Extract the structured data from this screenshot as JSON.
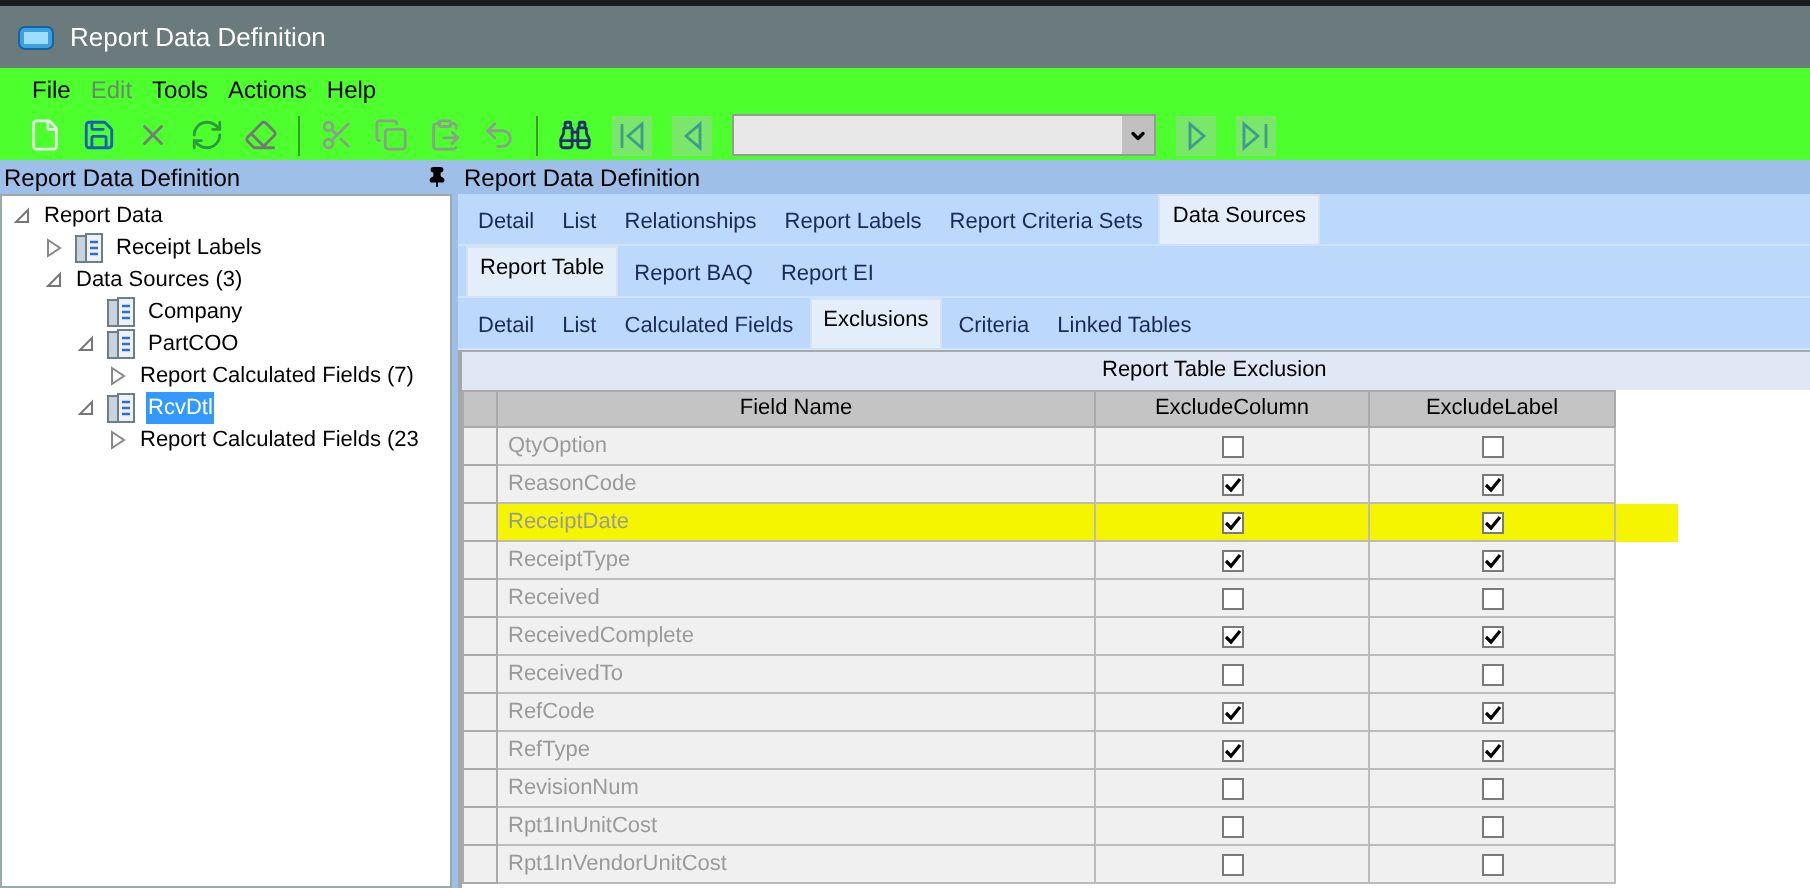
{
  "window": {
    "title": "Report Data Definition"
  },
  "menu": [
    {
      "label": "File",
      "disabled": false
    },
    {
      "label": "Edit",
      "disabled": true
    },
    {
      "label": "Tools",
      "disabled": false
    },
    {
      "label": "Actions",
      "disabled": false
    },
    {
      "label": "Help",
      "disabled": false
    }
  ],
  "left_panel": {
    "title": "Report Data Definition",
    "tree": [
      {
        "label": "Report Data",
        "expanded": true,
        "selected": false,
        "children": [
          {
            "label": "Receipt Labels",
            "kind": "book",
            "expanded": false,
            "selected": false
          },
          {
            "label": "Data Sources (3)",
            "expanded": true,
            "selected": false,
            "children": [
              {
                "label": "Company",
                "kind": "book",
                "selected": false
              },
              {
                "label": "PartCOO",
                "kind": "book",
                "expanded": true,
                "selected": false,
                "children": [
                  {
                    "label": "Report Calculated Fields (7)",
                    "expanded": false,
                    "selected": false
                  }
                ]
              },
              {
                "label": "RcvDtl",
                "kind": "book",
                "expanded": true,
                "selected": true,
                "children": [
                  {
                    "label": "Report Calculated Fields (23",
                    "expanded": false,
                    "selected": false
                  }
                ]
              }
            ]
          }
        ]
      }
    ]
  },
  "right_panel": {
    "title": "Report Data Definition",
    "tab_rows": [
      [
        {
          "label": "Detail",
          "selected": false
        },
        {
          "label": "List",
          "selected": false
        },
        {
          "label": "Relationships",
          "selected": false
        },
        {
          "label": "Report Labels",
          "selected": false
        },
        {
          "label": "Report Criteria Sets",
          "selected": false
        },
        {
          "label": "Data Sources",
          "selected": true
        }
      ],
      [
        {
          "label": "Report Table",
          "selected": true
        },
        {
          "label": "Report BAQ",
          "selected": false
        },
        {
          "label": "Report EI",
          "selected": false
        }
      ],
      [
        {
          "label": "Detail",
          "selected": false
        },
        {
          "label": "List",
          "selected": false
        },
        {
          "label": "Calculated Fields",
          "selected": false
        },
        {
          "label": "Exclusions",
          "selected": true
        },
        {
          "label": "Criteria",
          "selected": false
        },
        {
          "label": "Linked Tables",
          "selected": false
        }
      ]
    ],
    "grid": {
      "caption": "Report Table Exclusion",
      "columns": [
        "Field Name",
        "ExcludeColumn",
        "ExcludeLabel"
      ],
      "rows": [
        {
          "field": "QtyOption",
          "exclude_column": false,
          "exclude_label": false,
          "highlighted": false
        },
        {
          "field": "ReasonCode",
          "exclude_column": true,
          "exclude_label": true,
          "highlighted": false
        },
        {
          "field": "ReceiptDate",
          "exclude_column": true,
          "exclude_label": true,
          "highlighted": true
        },
        {
          "field": "ReceiptType",
          "exclude_column": true,
          "exclude_label": true,
          "highlighted": false
        },
        {
          "field": "Received",
          "exclude_column": false,
          "exclude_label": false,
          "highlighted": false
        },
        {
          "field": "ReceivedComplete",
          "exclude_column": true,
          "exclude_label": true,
          "highlighted": false
        },
        {
          "field": "ReceivedTo",
          "exclude_column": false,
          "exclude_label": false,
          "highlighted": false
        },
        {
          "field": "RefCode",
          "exclude_column": true,
          "exclude_label": true,
          "highlighted": false
        },
        {
          "field": "RefType",
          "exclude_column": true,
          "exclude_label": true,
          "highlighted": false
        },
        {
          "field": "RevisionNum",
          "exclude_column": false,
          "exclude_label": false,
          "highlighted": false
        },
        {
          "field": "Rpt1InUnitCost",
          "exclude_column": false,
          "exclude_label": false,
          "highlighted": false
        },
        {
          "field": "Rpt1InVendorUnitCost",
          "exclude_column": false,
          "exclude_label": false,
          "highlighted": false
        }
      ]
    }
  }
}
